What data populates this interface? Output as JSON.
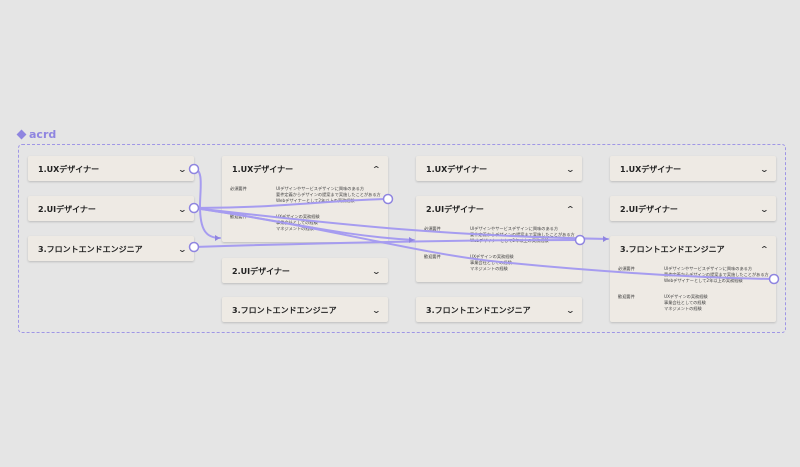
{
  "frame": {
    "name": "acrd",
    "icon": "component-diamond-icon"
  },
  "accordion": {
    "item1": "1.UXデザイナー",
    "item2": "2.UIデザイナー",
    "item3": "3.フロントエンドエンジニア"
  },
  "detail": {
    "required_label": "必須要件",
    "welcome_label": "歓迎要件",
    "required_lines": [
      "UIデザインやサービスデザインに興味のある方",
      "要件定義からデザインの提案まで実施したことがある方",
      "Webデザイナーとして2年以上の実務経験"
    ],
    "welcome_lines": [
      "UXデザインの実務経験",
      "事業会社としての経験",
      "マネジメントの経験"
    ]
  },
  "colors": {
    "accent": "#8f85e0",
    "card": "#eeeae4",
    "canvas": "#e5e5e5"
  }
}
